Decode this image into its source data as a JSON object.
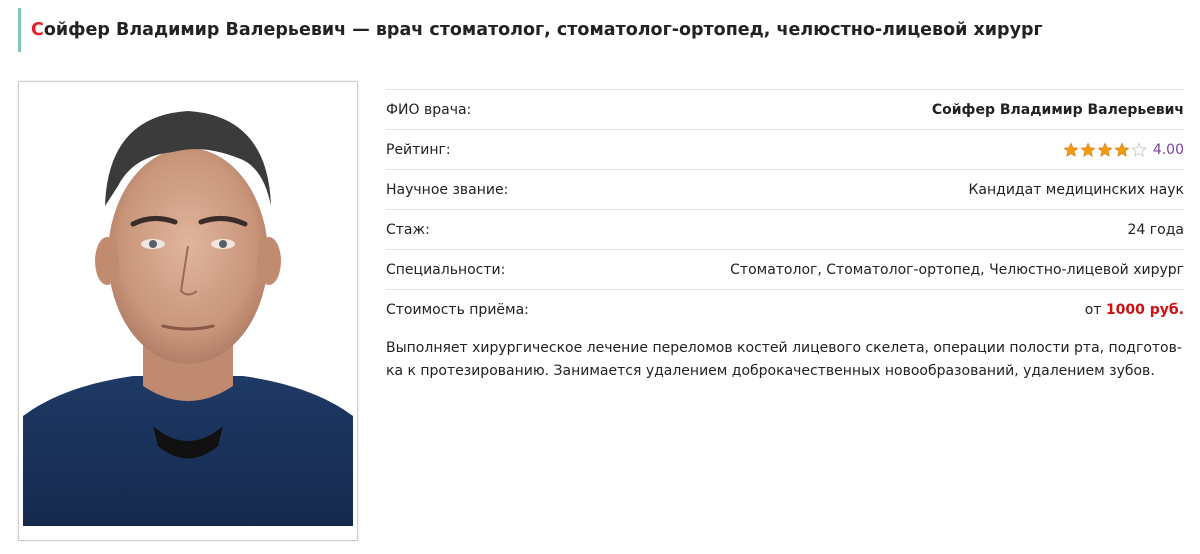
{
  "header": {
    "title_first_letter": "С",
    "title_rest": "ойфер Владимир Валерьевич — врач стоматолог, стоматолог-ортопед, челюстно-лицевой хирург"
  },
  "photo": {
    "icon": "doctor-portrait"
  },
  "info": {
    "name_label": "ФИО врача:",
    "name_value": "Сойфер Владимир Валерьевич",
    "rating_label": "Рейтинг:",
    "rating_value": "4.00",
    "rating_stars": 4,
    "degree_label": "Научное звание:",
    "degree_value": "Кандидат медицинских наук",
    "experience_label": "Стаж:",
    "experience_value": "24 года",
    "specialties_label": "Специальности:",
    "specialties_value": "Стоматолог, Стоматолог-ортопед, Челюстно-лицевой хирург",
    "price_label": "Стоимость приёма:",
    "price_prefix": "от",
    "price_value": "1000 руб."
  },
  "description": "Выполняет хирургическое лечение переломов костей лицевого скелета, операции полости рта, подготов-ка к протезированию. Занимается удалением доброкачественных новообразований, удалением зубов.",
  "colors": {
    "accent_border": "#7dc6b8",
    "title_first_letter": "#e41e26",
    "rating_number": "#7b3fa0",
    "price": "#cc1111",
    "star_filled": "#f39c12"
  }
}
